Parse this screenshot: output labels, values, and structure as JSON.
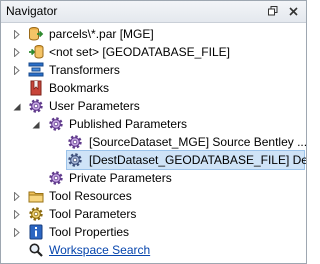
{
  "panel": {
    "title": "Navigator"
  },
  "items": [
    {
      "id": "reader",
      "label": "parcels\\*.par [MGE]",
      "icon": "reader-dataset-icon",
      "expander": "collapsed"
    },
    {
      "id": "writer",
      "label": "<not set> [GEODATABASE_FILE]",
      "icon": "writer-dataset-icon",
      "expander": "collapsed"
    },
    {
      "id": "transformers",
      "label": "Transformers",
      "icon": "transformers-icon",
      "expander": "collapsed"
    },
    {
      "id": "bookmarks",
      "label": "Bookmarks",
      "icon": "bookmarks-icon",
      "expander": "none"
    },
    {
      "id": "user-params",
      "label": "User Parameters",
      "icon": "gear-icon",
      "expander": "expanded"
    },
    {
      "id": "published-params",
      "label": "Published Parameters",
      "icon": "gear-icon",
      "expander": "expanded"
    },
    {
      "id": "source-dataset",
      "label": "[SourceDataset_MGE] Source Bentley ...",
      "icon": "gear-icon",
      "expander": "none"
    },
    {
      "id": "dest-dataset",
      "label": "[DestDataset_GEODATABASE_FILE] Des...",
      "icon": "gear-icon",
      "expander": "none",
      "selected": true
    },
    {
      "id": "private-params",
      "label": "Private Parameters",
      "icon": "gear-icon",
      "expander": "none"
    },
    {
      "id": "tool-resources",
      "label": "Tool Resources",
      "icon": "tool-resources-icon",
      "expander": "collapsed"
    },
    {
      "id": "tool-params",
      "label": "Tool Parameters",
      "icon": "gear-icon",
      "expander": "collapsed"
    },
    {
      "id": "tool-props",
      "label": "Tool Properties",
      "icon": "info-icon",
      "expander": "collapsed"
    },
    {
      "id": "workspace-search",
      "label": "Workspace Search",
      "icon": "search-icon",
      "expander": "none",
      "link": true
    }
  ]
}
